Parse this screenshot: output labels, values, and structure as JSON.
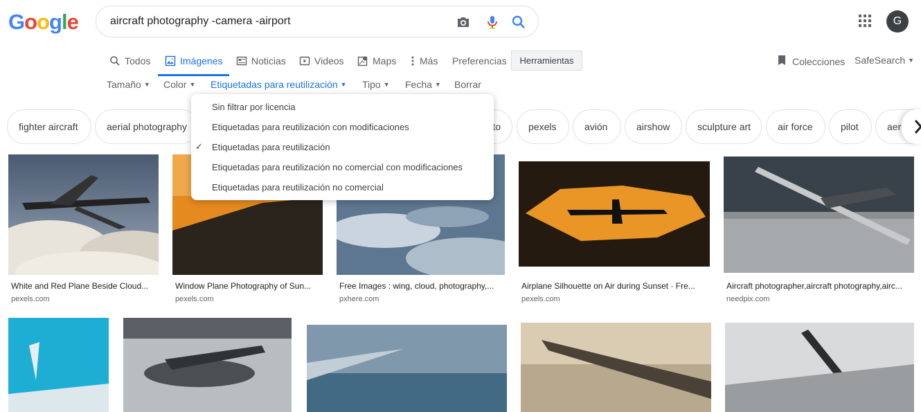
{
  "logo": {
    "G": "G",
    "o1": "o",
    "o2": "o",
    "g": "g",
    "l": "l",
    "e": "e"
  },
  "search": {
    "query": "aircraft photography -camera -airport"
  },
  "account": {
    "avatar_letter": "G"
  },
  "tabs": [
    {
      "label": "Todos",
      "icon": "search-icon"
    },
    {
      "label": "Imágenes",
      "icon": "image-icon",
      "active": true
    },
    {
      "label": "Noticias",
      "icon": "news-icon"
    },
    {
      "label": "Videos",
      "icon": "video-icon"
    },
    {
      "label": "Maps",
      "icon": "map-icon"
    },
    {
      "label": "Más",
      "icon": "more-vert-icon"
    },
    {
      "label": "Preferencias"
    },
    {
      "label": "Herramientas"
    }
  ],
  "collections_label": "Colecciones",
  "safesearch_label": "SafeSearch",
  "filters": [
    {
      "label": "Tamaño"
    },
    {
      "label": "Color"
    },
    {
      "label": "Etiquetadas para reutilización",
      "active": true
    },
    {
      "label": "Tipo"
    },
    {
      "label": "Fecha"
    },
    {
      "label": "Borrar"
    }
  ],
  "chips": [
    "fighter aircraft",
    "aerial photography",
    "to",
    "pexels",
    "avión",
    "airshow",
    "sculpture art",
    "air force",
    "pilot",
    "aero"
  ],
  "dropdown": {
    "items": [
      "Sin filtrar por licencia",
      "Etiquetadas para reutilización con modificaciones",
      "Etiquetadas para reutilización",
      "Etiquetadas para reutilización no comercial con modificaciones",
      "Etiquetadas para reutilización no comercial"
    ],
    "selected_index": 2
  },
  "results": [
    {
      "caption": "White and Red Plane Beside Cloud...",
      "source": "pexels.com"
    },
    {
      "caption": "Window Plane Photography of Sun...",
      "source": "pexels.com"
    },
    {
      "caption": "Free Images : wing, cloud, photography,...",
      "source": "pxhere.com"
    },
    {
      "caption": "Airplane Silhouette on Air during Sunset · Fre...",
      "source": "pexels.com"
    },
    {
      "caption": "Aircraft photographer,aircraft photography,airc...",
      "source": "needpix.com"
    }
  ],
  "colors": {
    "accent": "#1a73e8",
    "text_secondary": "#5f6368",
    "border": "#dfe1e5"
  }
}
